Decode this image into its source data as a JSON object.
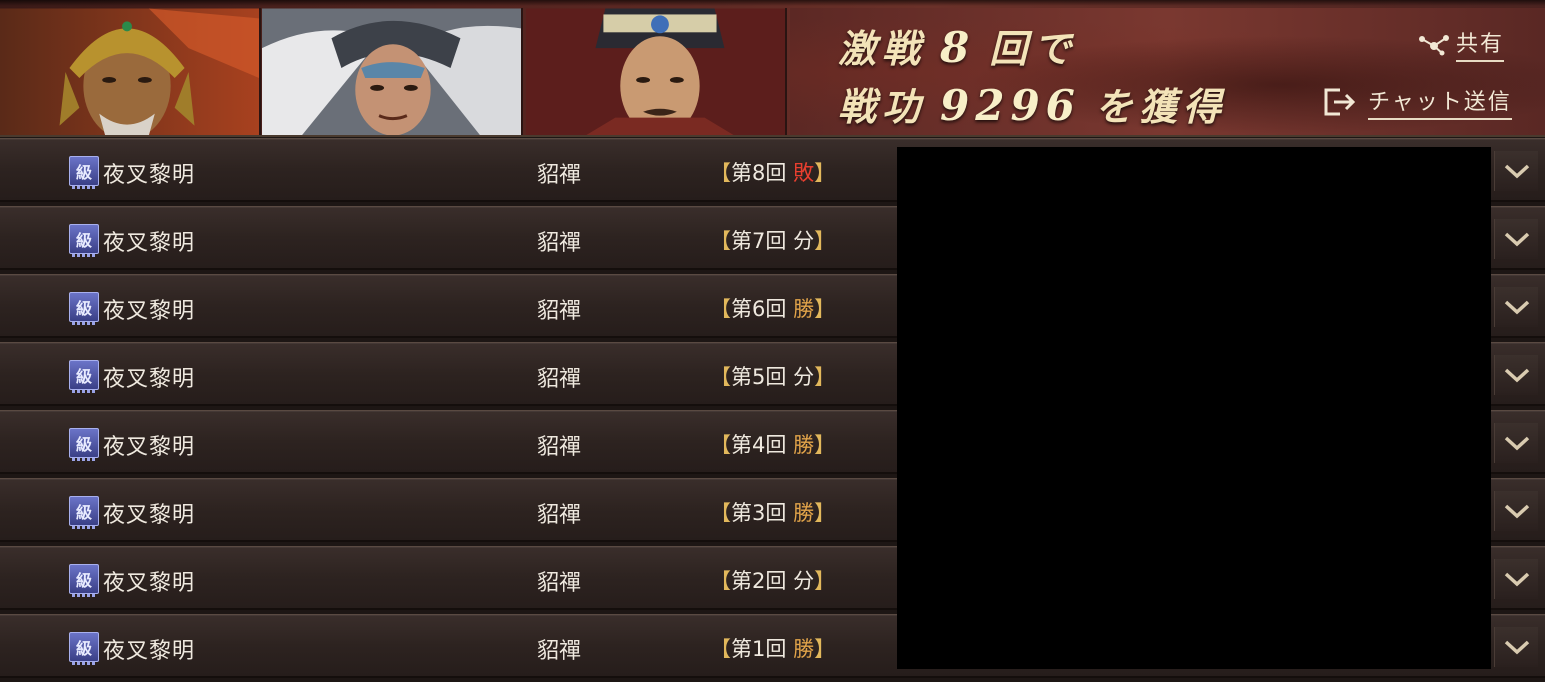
{
  "header": {
    "banner": {
      "line1_prefix": "激戦",
      "battle_count": "8",
      "line1_suffix": "回で",
      "line2_prefix": "戦功",
      "merit_points": "9296",
      "line2_suffix": "を獲得"
    },
    "share_label": "共有",
    "chat_label": "チャット送信"
  },
  "rows": [
    {
      "badge": "級",
      "player": "夜叉黎明",
      "opponent": "貂禪",
      "round_label": "第8回",
      "result": "敗",
      "result_type": "lose"
    },
    {
      "badge": "級",
      "player": "夜叉黎明",
      "opponent": "貂禪",
      "round_label": "第7回",
      "result": "分",
      "result_type": "draw"
    },
    {
      "badge": "級",
      "player": "夜叉黎明",
      "opponent": "貂禪",
      "round_label": "第6回",
      "result": "勝",
      "result_type": "win"
    },
    {
      "badge": "級",
      "player": "夜叉黎明",
      "opponent": "貂禪",
      "round_label": "第5回",
      "result": "分",
      "result_type": "draw"
    },
    {
      "badge": "級",
      "player": "夜叉黎明",
      "opponent": "貂禪",
      "round_label": "第4回",
      "result": "勝",
      "result_type": "win"
    },
    {
      "badge": "級",
      "player": "夜叉黎明",
      "opponent": "貂禪",
      "round_label": "第3回",
      "result": "勝",
      "result_type": "win"
    },
    {
      "badge": "級",
      "player": "夜叉黎明",
      "opponent": "貂禪",
      "round_label": "第2回",
      "result": "分",
      "result_type": "draw"
    },
    {
      "badge": "級",
      "player": "夜叉黎明",
      "opponent": "貂禪",
      "round_label": "第1回",
      "result": "勝",
      "result_type": "win"
    }
  ],
  "bracket_open": "【",
  "bracket_close": "】",
  "colors": {
    "win": "#e2a44a",
    "lose": "#e83f2f",
    "draw": "#efe9df",
    "badge": "#4b52a8"
  }
}
